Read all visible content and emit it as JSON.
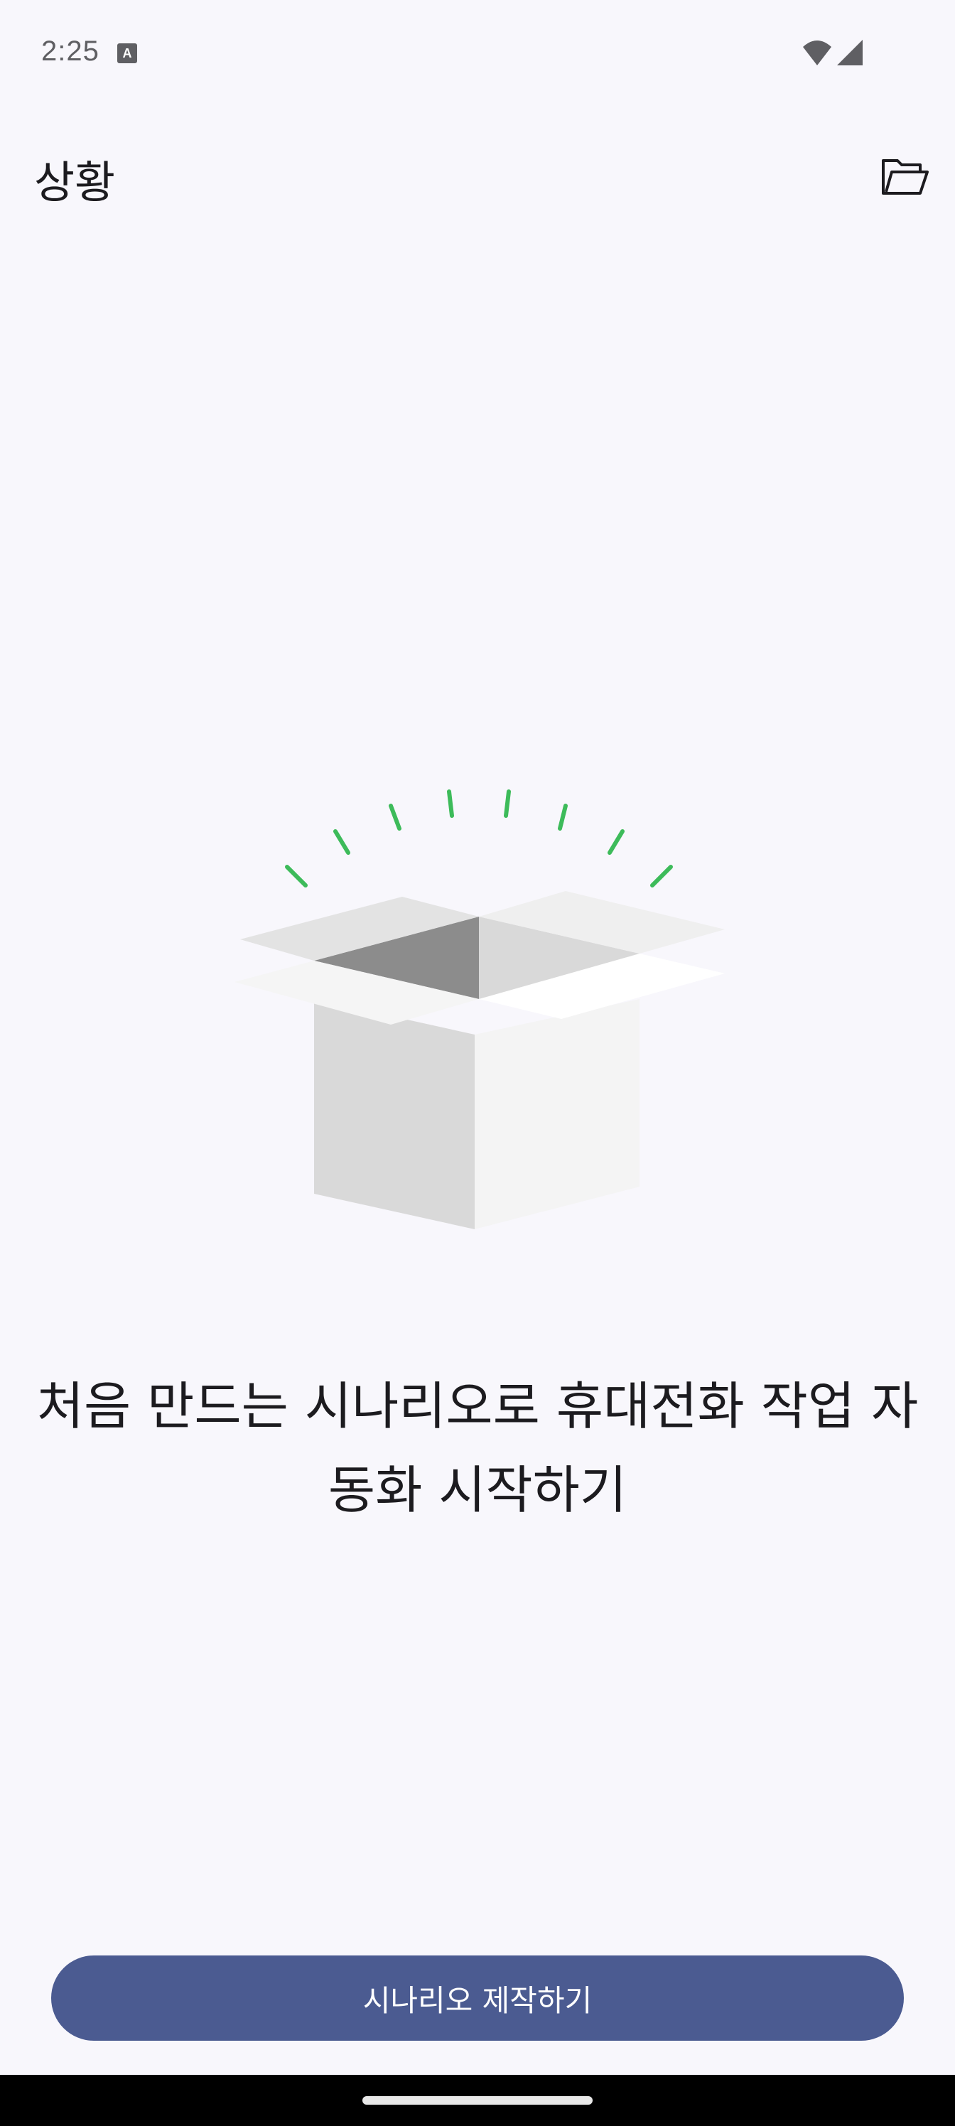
{
  "status_bar": {
    "time": "2:25",
    "notification_icon": "text-a-icon",
    "wifi_icon": "wifi-icon",
    "signal_icon": "cell-signal-icon"
  },
  "app_bar": {
    "title": "상황",
    "folder_icon": "folder-open-icon"
  },
  "empty_state": {
    "illustration": "open-box-illustration",
    "message": "처음 만드는 시나리오로 휴대전화 작업 자동화 시작하기"
  },
  "actions": {
    "create_label": "시나리오 제작하기"
  },
  "colors": {
    "background": "#f8f7fc",
    "primary_button": "#4b5b91",
    "accent_rays": "#3dbb5a"
  }
}
